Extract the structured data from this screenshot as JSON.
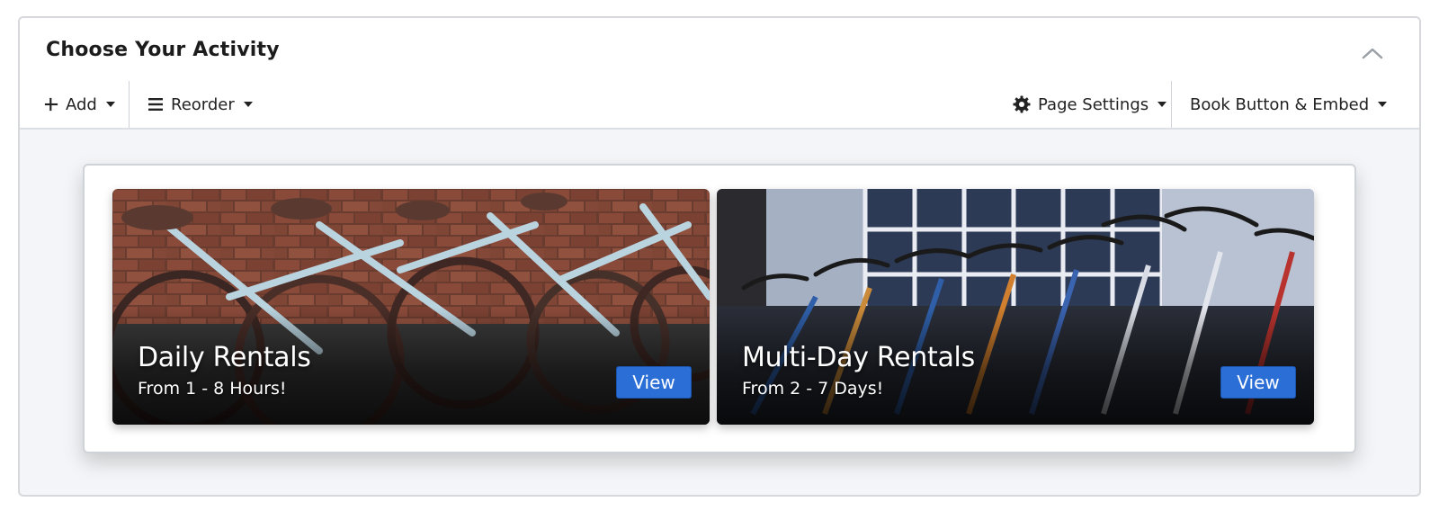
{
  "header": {
    "title": "Choose Your Activity",
    "collapse_icon": "chevron-up-icon"
  },
  "toolbar": {
    "add_label": "Add",
    "add_icon": "plus-icon",
    "reorder_label": "Reorder",
    "reorder_icon": "list-icon",
    "page_settings_label": "Page Settings",
    "page_settings_icon": "gear-icon",
    "book_button_label": "Book Button & Embed"
  },
  "activities": [
    {
      "title": "Daily Rentals",
      "subtitle": "From 1 - 8 Hours!",
      "button_label": "View",
      "image": "bicycle-rack-photo"
    },
    {
      "title": "Multi-Day Rentals",
      "subtitle": "From 2 - 7 Days!",
      "button_label": "View",
      "image": "bike-shop-storefront-photo"
    }
  ],
  "colors": {
    "accent": "#2a6ed6",
    "panel_background": "#f3f5f8",
    "border": "#d6d8db"
  }
}
